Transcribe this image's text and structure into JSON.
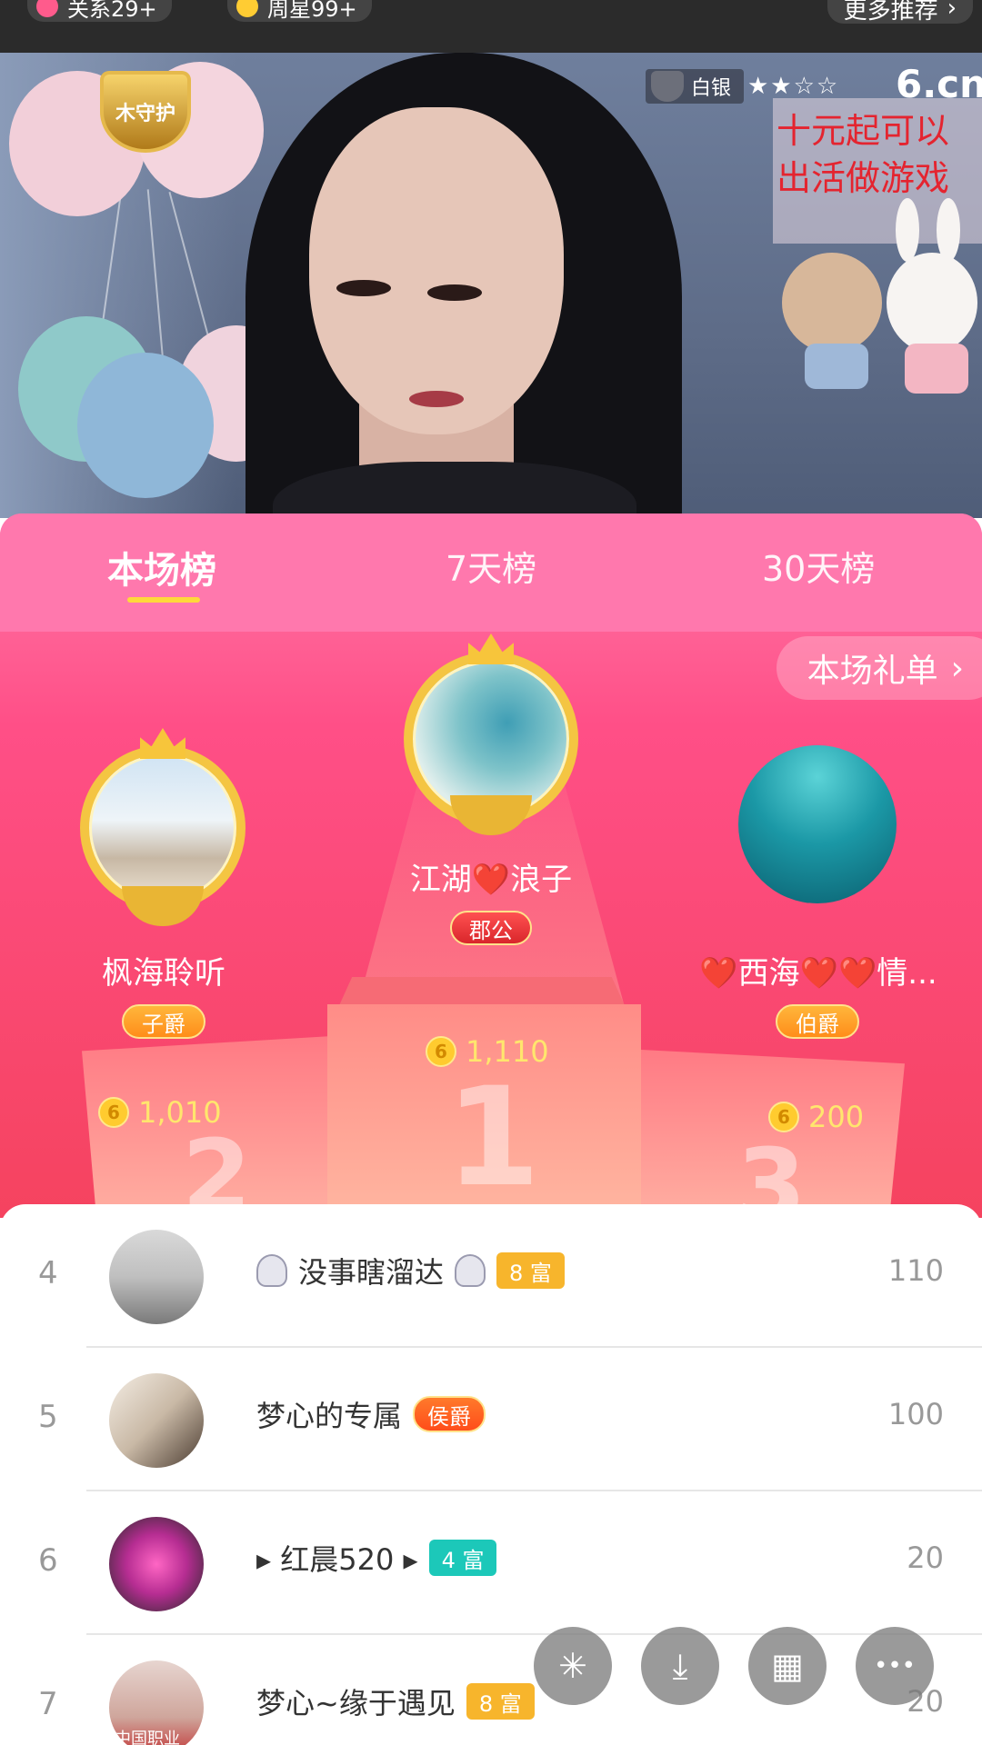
{
  "topbar": {
    "chip1_label": "关系29+",
    "chip2_label": "周星99+",
    "more_recommend": "更多推荐",
    "more_chevron": "›"
  },
  "video": {
    "guard_logo_text": "木守护",
    "rank_level": "白银",
    "stars": "★★☆☆",
    "site_logo": "6.cn",
    "promo_text_line1": "十元起可以",
    "promo_text_line2": "出活做游戏"
  },
  "board": {
    "tabs": [
      {
        "label": "本场榜",
        "active": true
      },
      {
        "label": "7天榜",
        "active": false
      },
      {
        "label": "30天榜",
        "active": false
      }
    ],
    "gift_list_label": "本场礼单",
    "gift_list_chevron": "›",
    "podium": [
      {
        "rank": "1",
        "name": "江湖❤️浪子",
        "title": "郡公",
        "coins": "1,110"
      },
      {
        "rank": "2",
        "name": "枫海聆听",
        "title": "子爵",
        "coins": "1,010"
      },
      {
        "rank": "3",
        "name": "❤️西海❤️❤️情...",
        "title": "伯爵",
        "coins": "200"
      }
    ],
    "coin_glyph": "6"
  },
  "list": {
    "rows": [
      {
        "rank": "4",
        "name": "没事瞎溜达",
        "badge": "8 富",
        "badge_color": "#f7b52c",
        "score": "110"
      },
      {
        "rank": "5",
        "name": "梦心的专属",
        "badge": "侯爵",
        "badge_color": "#ff6a2b",
        "score": "100"
      },
      {
        "rank": "6",
        "name": "▸ 红晨520 ▸",
        "badge": "4 富",
        "badge_color": "#1cc8b9",
        "score": "20"
      },
      {
        "rank": "7",
        "name": "梦心~缘于遇见",
        "badge": "8 富",
        "badge_color": "#f7b52c",
        "score": "20"
      }
    ],
    "row7_avatar_text": "中国职业"
  },
  "fabs": [
    {
      "icon": "sparkle-icon",
      "glyph": "✳"
    },
    {
      "icon": "download-icon",
      "glyph": "⤓"
    },
    {
      "icon": "grid-icon",
      "glyph": "▦"
    },
    {
      "icon": "more-icon",
      "glyph": "•••"
    }
  ],
  "colors": {
    "board_pink": "#ff4f87",
    "tab_underline": "#ffd83a",
    "coin_gold": "#ffcb2f"
  }
}
